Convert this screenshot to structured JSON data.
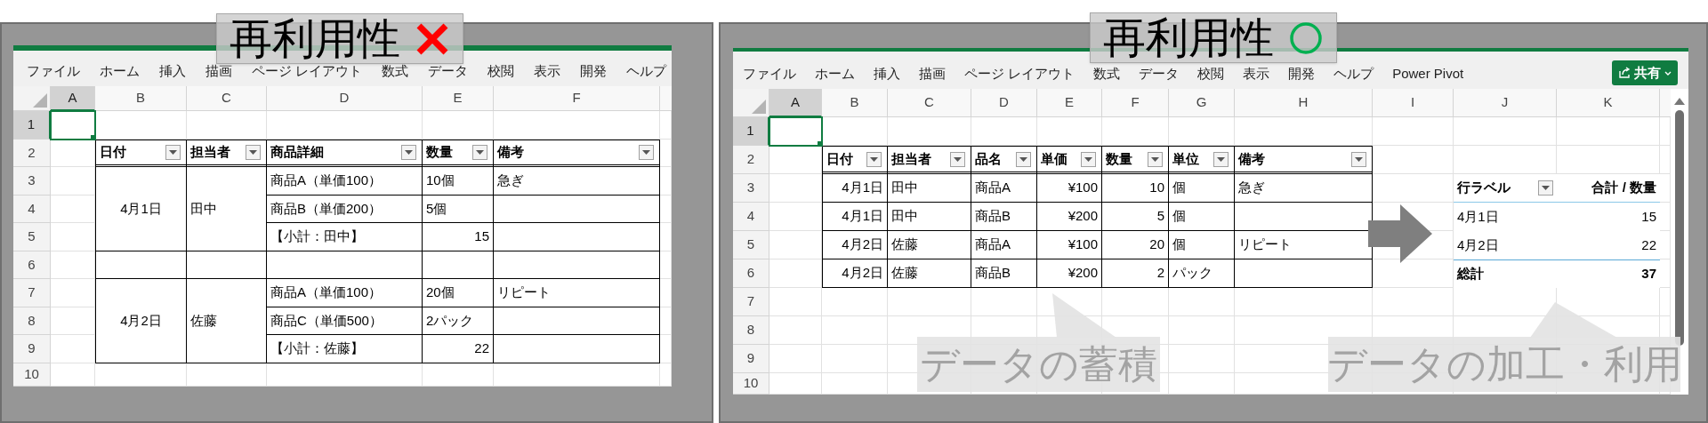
{
  "panels": [
    {
      "badge": {
        "label": "再利用性",
        "kind": "cross"
      },
      "menu": [
        "ファイル",
        "ホーム",
        "挿入",
        "描画",
        "ページ レイアウト",
        "数式",
        "データ",
        "校閲",
        "表示",
        "開発",
        "ヘルプ"
      ],
      "columns": [
        {
          "label": "A",
          "selected": true
        },
        {
          "label": "B",
          "selected": false
        },
        {
          "label": "C",
          "selected": false
        },
        {
          "label": "D",
          "selected": false
        },
        {
          "label": "E",
          "selected": false
        },
        {
          "label": "F",
          "selected": false
        }
      ],
      "rows": [
        {
          "label": "1",
          "selected": true
        },
        {
          "label": "2",
          "selected": false,
          "cells": [
            null,
            {
              "kind": "header",
              "text": "日付",
              "filter": true
            },
            {
              "kind": "header",
              "text": "担当者",
              "filter": true
            },
            {
              "kind": "header",
              "text": "商品詳細",
              "filter": true
            },
            {
              "kind": "header",
              "text": "数量",
              "filter": true
            },
            {
              "kind": "header",
              "text": "備考",
              "filter": true
            }
          ]
        },
        {
          "label": "3",
          "selected": false,
          "cells": [
            null,
            {
              "kind": "centered",
              "text": "4月1日"
            },
            {
              "kind": "text",
              "text": "田中"
            },
            {
              "kind": "text",
              "text": "商品A（単価100）"
            },
            {
              "kind": "text",
              "text": "10個"
            },
            {
              "kind": "text",
              "text": "急ぎ"
            }
          ]
        },
        {
          "label": "4",
          "selected": false,
          "cells": [
            null,
            {
              "kind": "merged"
            },
            {
              "kind": "merged"
            },
            {
              "kind": "text",
              "text": "商品B（単価200）"
            },
            {
              "kind": "text",
              "text": "5個"
            },
            {
              "kind": "boxed"
            }
          ]
        },
        {
          "label": "5",
          "selected": false,
          "cells": [
            null,
            {
              "kind": "merged"
            },
            {
              "kind": "merged"
            },
            {
              "kind": "text",
              "text": "【小計：田中】"
            },
            {
              "kind": "number",
              "text": "15"
            },
            {
              "kind": "boxed"
            }
          ]
        },
        {
          "label": "6",
          "selected": false,
          "cells": [
            null,
            {
              "kind": "boxed"
            },
            {
              "kind": "boxed"
            },
            {
              "kind": "boxed"
            },
            {
              "kind": "boxed"
            },
            {
              "kind": "boxed"
            }
          ]
        },
        {
          "label": "7",
          "selected": false,
          "cells": [
            null,
            {
              "kind": "centered",
              "text": "4月2日"
            },
            {
              "kind": "text",
              "text": "佐藤"
            },
            {
              "kind": "text",
              "text": "商品A（単価100）"
            },
            {
              "kind": "text",
              "text": "20個"
            },
            {
              "kind": "text",
              "text": "リピート"
            }
          ]
        },
        {
          "label": "8",
          "selected": false,
          "cells": [
            null,
            {
              "kind": "merged"
            },
            {
              "kind": "merged"
            },
            {
              "kind": "text",
              "text": "商品C（単価500）"
            },
            {
              "kind": "text",
              "text": "2パック"
            },
            {
              "kind": "boxed"
            }
          ]
        },
        {
          "label": "9",
          "selected": false,
          "cells": [
            null,
            {
              "kind": "merged"
            },
            {
              "kind": "merged"
            },
            {
              "kind": "text",
              "text": "【小計：佐藤】"
            },
            {
              "kind": "number",
              "text": "22"
            },
            {
              "kind": "boxed"
            }
          ]
        },
        {
          "label": "10",
          "selected": false
        }
      ]
    },
    {
      "badge": {
        "label": "再利用性",
        "kind": "circle"
      },
      "menu": [
        "ファイル",
        "ホーム",
        "挿入",
        "描画",
        "ページ レイアウト",
        "数式",
        "データ",
        "校閲",
        "表示",
        "開発",
        "ヘルプ",
        "Power Pivot"
      ],
      "share_button": {
        "label": "共有"
      },
      "columns": [
        {
          "label": "A",
          "selected": true
        },
        {
          "label": "B",
          "selected": false
        },
        {
          "label": "C",
          "selected": false
        },
        {
          "label": "D",
          "selected": false
        },
        {
          "label": "E",
          "selected": false
        },
        {
          "label": "F",
          "selected": false
        },
        {
          "label": "G",
          "selected": false
        },
        {
          "label": "H",
          "selected": false
        },
        {
          "label": "I",
          "selected": false
        },
        {
          "label": "J",
          "selected": false
        },
        {
          "label": "K",
          "selected": false
        }
      ],
      "rows": [
        {
          "label": "1",
          "selected": true
        },
        {
          "label": "2",
          "selected": false,
          "cells": [
            null,
            {
              "kind": "header",
              "text": "日付",
              "filter": true
            },
            {
              "kind": "header",
              "text": "担当者",
              "filter": true
            },
            {
              "kind": "header",
              "text": "品名",
              "filter": true
            },
            {
              "kind": "header",
              "text": "単価",
              "filter": true
            },
            {
              "kind": "header",
              "text": "数量",
              "filter": true
            },
            {
              "kind": "header",
              "text": "単位",
              "filter": true
            },
            {
              "kind": "header",
              "text": "備考",
              "filter": true
            }
          ]
        },
        {
          "label": "3",
          "selected": false,
          "cells": [
            null,
            {
              "kind": "number",
              "text": "4月1日"
            },
            {
              "kind": "text",
              "text": "田中"
            },
            {
              "kind": "text",
              "text": "商品A"
            },
            {
              "kind": "number",
              "text": "¥100"
            },
            {
              "kind": "number",
              "text": "10"
            },
            {
              "kind": "text",
              "text": "個"
            },
            {
              "kind": "text",
              "text": "急ぎ"
            },
            null,
            {
              "kind": "pivot_header",
              "text": "行ラベル",
              "filter": true
            },
            {
              "kind": "pivot_header",
              "text": "合計 / 数量",
              "filter": false
            }
          ]
        },
        {
          "label": "4",
          "selected": false,
          "cells": [
            null,
            {
              "kind": "number",
              "text": "4月1日"
            },
            {
              "kind": "text",
              "text": "田中"
            },
            {
              "kind": "text",
              "text": "商品B"
            },
            {
              "kind": "number",
              "text": "¥200"
            },
            {
              "kind": "number",
              "text": "5"
            },
            {
              "kind": "text",
              "text": "個"
            },
            {
              "kind": "boxed"
            },
            null,
            {
              "kind": "pivot_item",
              "text": "4月1日"
            },
            {
              "kind": "pivot_value",
              "text": "15"
            }
          ]
        },
        {
          "label": "5",
          "selected": false,
          "cells": [
            null,
            {
              "kind": "number",
              "text": "4月2日"
            },
            {
              "kind": "text",
              "text": "佐藤"
            },
            {
              "kind": "text",
              "text": "商品A"
            },
            {
              "kind": "number",
              "text": "¥100"
            },
            {
              "kind": "number",
              "text": "20"
            },
            {
              "kind": "text",
              "text": "個"
            },
            {
              "kind": "text",
              "text": "リピート"
            },
            null,
            {
              "kind": "pivot_item",
              "text": "4月2日"
            },
            {
              "kind": "pivot_value",
              "text": "22"
            }
          ]
        },
        {
          "label": "6",
          "selected": false,
          "cells": [
            null,
            {
              "kind": "number",
              "text": "4月2日"
            },
            {
              "kind": "text",
              "text": "佐藤"
            },
            {
              "kind": "text",
              "text": "商品B"
            },
            {
              "kind": "number",
              "text": "¥200"
            },
            {
              "kind": "number",
              "text": "2"
            },
            {
              "kind": "text",
              "text": "パック"
            },
            {
              "kind": "boxed"
            },
            null,
            {
              "kind": "pivot_total_label",
              "text": "総計"
            },
            {
              "kind": "pivot_total_value",
              "text": "37"
            }
          ]
        },
        {
          "label": "7",
          "selected": false
        },
        {
          "label": "8",
          "selected": false
        },
        {
          "label": "9",
          "selected": false
        },
        {
          "label": "10",
          "selected": false
        }
      ],
      "callouts": [
        {
          "text": "データの蓄積"
        },
        {
          "text": "データの加工・利用"
        }
      ]
    }
  ]
}
